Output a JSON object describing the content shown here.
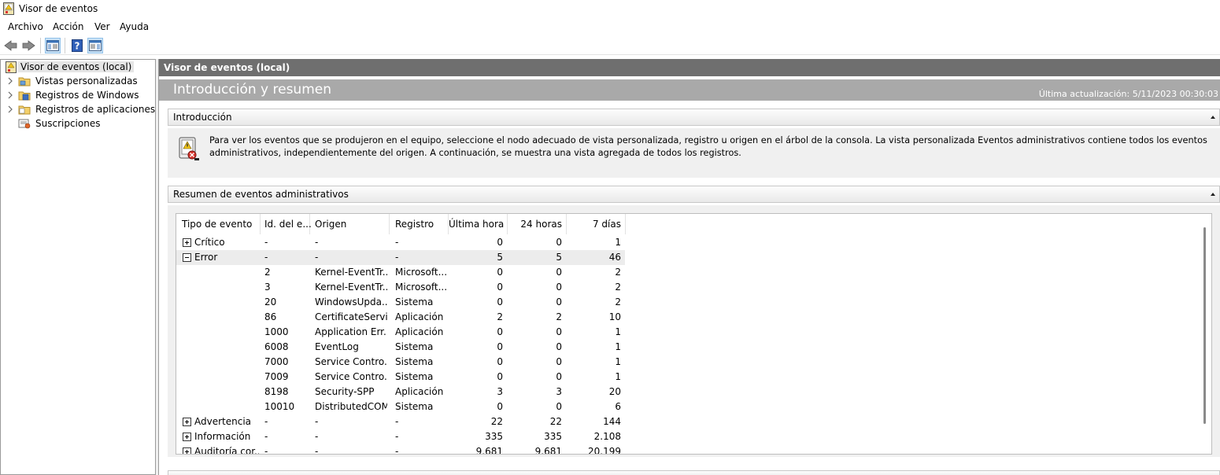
{
  "window": {
    "title": "Visor de eventos"
  },
  "menu": [
    "Archivo",
    "Acción",
    "Ver",
    "Ayuda"
  ],
  "toolbar": {
    "buttons": [
      "back-icon",
      "forward-icon",
      "show-hide-console-tree-icon",
      "help-icon",
      "show-hide-action-pane-icon"
    ]
  },
  "tree": {
    "root": "Visor de eventos (local)",
    "items": [
      {
        "label": "Vistas personalizadas",
        "icon": "folder-icon"
      },
      {
        "label": "Registros de Windows",
        "icon": "folder-log-icon"
      },
      {
        "label": "Registros de aplicaciones y s",
        "icon": "folder-icon"
      },
      {
        "label": "Suscripciones",
        "icon": "subscriptions-icon"
      }
    ]
  },
  "main": {
    "header": "Visor de eventos (local)",
    "banner_title": "Introducción y resumen",
    "last_update": "Última actualización: 5/11/2023 00:30:03",
    "intro": {
      "title": "Introducción",
      "text": "Para ver los eventos que se produjeron en el equipo, seleccione el nodo adecuado de vista personalizada, registro u origen en el árbol de la consola. La vista personalizada Eventos administrativos contiene todos los eventos administrativos, independientemente del origen. A continuación, se muestra una vista agregada de todos los registros."
    },
    "summary": {
      "title": "Resumen de eventos administrativos",
      "columns": [
        "Tipo de evento",
        "Id. del e...",
        "Origen",
        "Registro",
        "Última hora",
        "24 horas",
        "7 días"
      ],
      "rows": [
        {
          "type": "Crítico",
          "expander": "plus",
          "id": "-",
          "origin": "-",
          "log": "-",
          "hour": "0",
          "day": "0",
          "week": "1"
        },
        {
          "type": "Error",
          "expander": "minus",
          "id": "-",
          "origin": "-",
          "log": "-",
          "hour": "5",
          "day": "5",
          "week": "46"
        },
        {
          "type": "",
          "expander": "",
          "id": "2",
          "origin": "Kernel-EventTr...",
          "log": "Microsoft...",
          "hour": "0",
          "day": "0",
          "week": "2"
        },
        {
          "type": "",
          "expander": "",
          "id": "3",
          "origin": "Kernel-EventTr...",
          "log": "Microsoft...",
          "hour": "0",
          "day": "0",
          "week": "2"
        },
        {
          "type": "",
          "expander": "",
          "id": "20",
          "origin": "WindowsUpda...",
          "log": "Sistema",
          "hour": "0",
          "day": "0",
          "week": "2"
        },
        {
          "type": "",
          "expander": "",
          "id": "86",
          "origin": "CertificateServi...",
          "log": "Aplicación",
          "hour": "2",
          "day": "2",
          "week": "10"
        },
        {
          "type": "",
          "expander": "",
          "id": "1000",
          "origin": "Application Err...",
          "log": "Aplicación",
          "hour": "0",
          "day": "0",
          "week": "1"
        },
        {
          "type": "",
          "expander": "",
          "id": "6008",
          "origin": "EventLog",
          "log": "Sistema",
          "hour": "0",
          "day": "0",
          "week": "1"
        },
        {
          "type": "",
          "expander": "",
          "id": "7000",
          "origin": "Service Contro...",
          "log": "Sistema",
          "hour": "0",
          "day": "0",
          "week": "1"
        },
        {
          "type": "",
          "expander": "",
          "id": "7009",
          "origin": "Service Contro...",
          "log": "Sistema",
          "hour": "0",
          "day": "0",
          "week": "1"
        },
        {
          "type": "",
          "expander": "",
          "id": "8198",
          "origin": "Security-SPP",
          "log": "Aplicación",
          "hour": "3",
          "day": "3",
          "week": "20"
        },
        {
          "type": "",
          "expander": "",
          "id": "10010",
          "origin": "DistributedCOM",
          "log": "Sistema",
          "hour": "0",
          "day": "0",
          "week": "6"
        },
        {
          "type": "Advertencia",
          "expander": "plus",
          "id": "-",
          "origin": "-",
          "log": "-",
          "hour": "22",
          "day": "22",
          "week": "144"
        },
        {
          "type": "Información",
          "expander": "plus",
          "id": "-",
          "origin": "-",
          "log": "-",
          "hour": "335",
          "day": "335",
          "week": "2.108"
        },
        {
          "type": "Auditoría cor...",
          "expander": "plus",
          "id": "-",
          "origin": "-",
          "log": "-",
          "hour": "9.681",
          "day": "9.681",
          "week": "20.199"
        }
      ]
    }
  },
  "colors": {
    "header_bg": "#6f6f6f",
    "banner_bg": "#a9a9a9",
    "selected_row": "#ececec"
  }
}
